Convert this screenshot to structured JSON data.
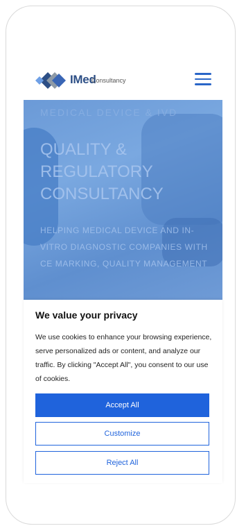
{
  "header": {
    "logo_text": "IMed",
    "logo_sub": "Consultancy",
    "menu_icon": "hamburger-menu-icon"
  },
  "hero": {
    "eyebrow": "MEDICAL DEVICE & IVD",
    "title": "QUALITY & REGULATORY CONSULTANCY",
    "subtitle": "HELPING MEDICAL DEVICE AND IN-VITRO DIAGNOSTIC COMPANIES WITH CE MARKING, QUALITY MANAGEMENT"
  },
  "consent": {
    "title": "We value your privacy",
    "body": "We use cookies to enhance your browsing experience, serve personalized ads or content, and analyze our traffic. By clicking \"Accept All\", you consent to our use of cookies.",
    "accept_label": "Accept All",
    "customize_label": "Customize",
    "reject_label": "Reject All"
  },
  "colors": {
    "accent": "#1f63dc",
    "logo": "#2d4f86",
    "hero_overlay": "#6b9ad7"
  }
}
